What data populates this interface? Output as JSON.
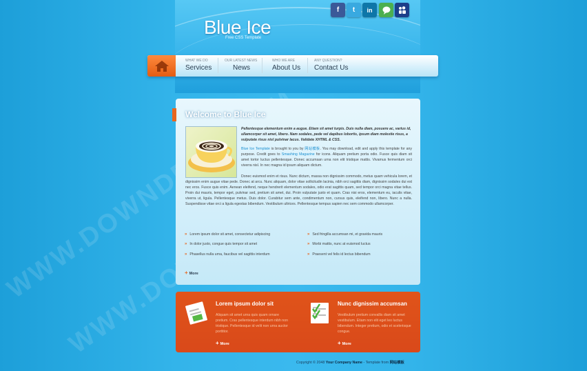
{
  "site": {
    "title": "Blue Ice",
    "subtitle": "Free CSS Template"
  },
  "social": [
    {
      "name": "facebook-icon",
      "glyph": "f",
      "color": "#3b5998"
    },
    {
      "name": "twitter-icon",
      "glyph": "t",
      "color": "#39a9e0"
    },
    {
      "name": "linkedin-icon",
      "glyph": "in",
      "color": "#0e76a8"
    },
    {
      "name": "chat-icon",
      "glyph": "●",
      "color": "#4caf50"
    },
    {
      "name": "myspace-icon",
      "glyph": "✚",
      "color": "#1c3f8a"
    }
  ],
  "nav": {
    "home_icon": "home-icon",
    "items": [
      {
        "small": "WHAT WE DO",
        "label": "Services"
      },
      {
        "small": "OUR LATEST NEWS",
        "label": "News"
      },
      {
        "small": "WHO WE ARE",
        "label": "About Us"
      },
      {
        "small": "ANY QUESTION?",
        "label": "Contact Us"
      }
    ]
  },
  "welcome": {
    "title": "Welcome to Blue Ice",
    "intro": "Pellentesque elementum enim a augue. Etiam sit amet turpis. Duis nulla diam, posuere ac, varius id, ullamcorper sit amet, libero. Nam sodales, pede vel dapibus lobortis, ipsum diam molestie risus, a vulputate risus nisl pulvinar lacus. Validate XHTML & CSS.",
    "para2_link1": "Blue Ice Template",
    "para2_a": " is brought to you by ",
    "para2_link2": "网站模板",
    "para2_b": ". You may download, edit and apply this template for any purpose. Credit goes to ",
    "para2_link3": "Smashing Magazine",
    "para2_c": " for icons. Aliquam pretium porta odio. Fusce quis diam sit amet tortor luctus pellentesque. Donec accumsan urna non elit tristique mattis. Vivamus fermentum orci viverra nisl. In nec magna id ipsum aliquam dictum.",
    "para3": "Donec euismod enim et risus. Nunc dictum, massa non dignissim commodo, metus quam vehicula lorem, et dignissim enim augue vitae pede. Donec at arcu. Nunc aliquam, dolor vitae sollicitudin lacinia, nibh orci sagittis diam, dignissim sodales dui est nec eros. Fusce quis enim. Aenean eleifend, neque hendrerit elementum sodales, odio erat sagittis quam, sed tempor orci magna vitae tellus. Proin dui mauris, tempor eget, pulvinar sed, pretium sit amet, dui. Proin vulputate justo et quam. Cras nisi eros, elementum eu, iaculis vitae, viverra ut, ligula. Pellentesque metus. Duis dolor. Curabitur sem ante, condimentum non, cursus quis, eleifend non, libero. Nunc a nulla. Suspendisse vitae orci a ligula egestas bibendum. Vestibulum ultrices. Pellentesque tempus sapien nec sem commodo ullamcorper.",
    "bullets_left": [
      "Lorem ipsum dolor sit amet, consectetur adipiscing",
      "In dolor justo, congue quis tempor sit amet",
      "Phasellus nulla urna, faucibus vel sagittis interdum"
    ],
    "bullets_right": [
      "Sed fringilla accumsan mi, et gravida mauris",
      "Morbi mattis, nunc at euismod luctus",
      "Praesent vel felis id lectus bibendum"
    ],
    "more": "More"
  },
  "boxes": [
    {
      "icon": "document-chart-icon",
      "title": "Lorem ipsum dolor sit",
      "text": "Aliquam sit amet urna quis quam ornare pretium. Cras pellentesque interdum nibh non tristique. Pellentesque id velit non urna auctor porttitor.",
      "more": "More"
    },
    {
      "icon": "checklist-icon",
      "title": "Nunc dignissim accumsan",
      "text": "Vestibulum pretium convallis diam sit amet vestibulum. Etiam non elit eget leo luctus bibendum. Integer pretium, odio et scelerisque congue.",
      "more": "More"
    }
  ],
  "footer": {
    "prefix": "Copyright © 2048 ",
    "company": "Your Company Name",
    "mid": " - Template from ",
    "source": "网站模板"
  },
  "watermark": "WWW.DOWNDEMO.COM"
}
